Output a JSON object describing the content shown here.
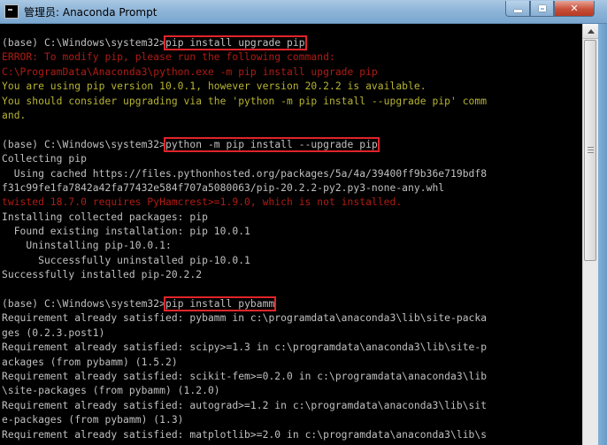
{
  "window": {
    "title": "管理员: Anaconda Prompt"
  },
  "console": {
    "lines": [
      {
        "text": "(base) C:\\Windows\\system32>",
        "cmd": "pip install upgrade pip",
        "kind": "prompt"
      },
      {
        "text": "ERROR: To modify pip, please run the following command:",
        "kind": "error"
      },
      {
        "text": "C:\\ProgramData\\Anaconda3\\python.exe -m pip install upgrade pip",
        "kind": "error"
      },
      {
        "text": "You are using pip version 10.0.1, however version 20.2.2 is available.",
        "kind": "warn"
      },
      {
        "text": "You should consider upgrading via the 'python -m pip install --upgrade pip' comm",
        "kind": "warn"
      },
      {
        "text": "and.",
        "kind": "warn"
      },
      {
        "text": "",
        "kind": "normal"
      },
      {
        "text": "(base) C:\\Windows\\system32>",
        "cmd": "python -m pip install --upgrade pip",
        "kind": "prompt"
      },
      {
        "text": "Collecting pip",
        "kind": "normal"
      },
      {
        "text": "  Using cached https://files.pythonhosted.org/packages/5a/4a/39400ff9b36e719bdf8",
        "kind": "normal"
      },
      {
        "text": "f31c99fe1fa7842a42fa77432e584f707a5080063/pip-20.2.2-py2.py3-none-any.whl",
        "kind": "normal"
      },
      {
        "text": "twisted 18.7.0 requires PyHamcrest>=1.9.0, which is not installed.",
        "kind": "error"
      },
      {
        "text": "Installing collected packages: pip",
        "kind": "normal"
      },
      {
        "text": "  Found existing installation: pip 10.0.1",
        "kind": "normal"
      },
      {
        "text": "    Uninstalling pip-10.0.1:",
        "kind": "normal"
      },
      {
        "text": "      Successfully uninstalled pip-10.0.1",
        "kind": "normal"
      },
      {
        "text": "Successfully installed pip-20.2.2",
        "kind": "normal"
      },
      {
        "text": "",
        "kind": "normal"
      },
      {
        "text": "(base) C:\\Windows\\system32>",
        "cmd": "pip install pybamm",
        "kind": "prompt"
      },
      {
        "text": "Requirement already satisfied: pybamm in c:\\programdata\\anaconda3\\lib\\site-packa",
        "kind": "normal"
      },
      {
        "text": "ges (0.2.3.post1)",
        "kind": "normal"
      },
      {
        "text": "Requirement already satisfied: scipy>=1.3 in c:\\programdata\\anaconda3\\lib\\site-p",
        "kind": "normal"
      },
      {
        "text": "ackages (from pybamm) (1.5.2)",
        "kind": "normal"
      },
      {
        "text": "Requirement already satisfied: scikit-fem>=0.2.0 in c:\\programdata\\anaconda3\\lib",
        "kind": "normal"
      },
      {
        "text": "\\site-packages (from pybamm) (1.2.0)",
        "kind": "normal"
      },
      {
        "text": "Requirement already satisfied: autograd>=1.2 in c:\\programdata\\anaconda3\\lib\\sit",
        "kind": "normal"
      },
      {
        "text": "e-packages (from pybamm) (1.3)",
        "kind": "normal"
      },
      {
        "text": "Requirement already satisfied: matplotlib>=2.0 in c:\\programdata\\anaconda3\\lib\\s",
        "kind": "normal"
      }
    ]
  },
  "colors": {
    "error": "#b01c14",
    "warning": "#b7b432",
    "text": "#c0c0c0",
    "highlight_box": "#e0242a"
  }
}
